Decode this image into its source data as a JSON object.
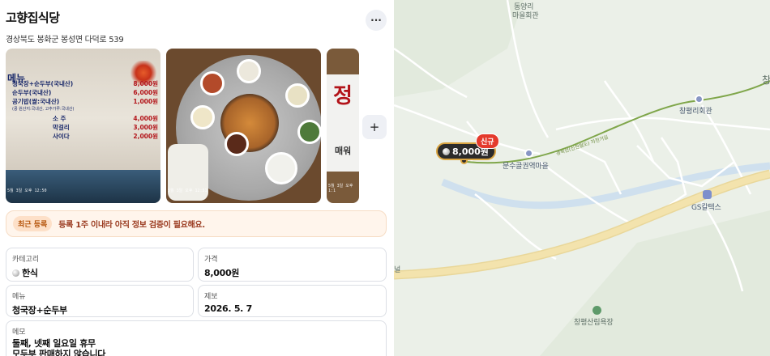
{
  "place": {
    "title": "고향집식당",
    "address": "경상북도 봉화군 봉성면 다덕로 539"
  },
  "actions": {
    "more_icon": "more-icon",
    "more_label": "···",
    "add_label": "+"
  },
  "photos": [
    {
      "stamp": "5월 3일 오후 12:50",
      "menu": [
        {
          "name": "청국장+순두부(국내산)",
          "price": "8,000원"
        },
        {
          "name": "순두부(국내산)",
          "price": "6,000원"
        },
        {
          "name": "공기밥(쌀:국내산)",
          "price": "1,000원"
        }
      ],
      "menu_note": "(콩 원산지:국내산, 고추가루:국내산)",
      "drinks": [
        {
          "name": "소 주",
          "price": "4,000원"
        },
        {
          "name": "막걸리",
          "price": "3,000원"
        },
        {
          "name": "사이다",
          "price": "2,000원"
        }
      ],
      "header_text": "메뉴"
    },
    {
      "stamp": "5월 3일 오후 12:51"
    },
    {
      "stamp": "5월 3일 오후 1:1",
      "sign": "정",
      "sign_sub": "매워"
    }
  ],
  "notice": {
    "badge": "최근 등록",
    "text": "등록 1주 이내라 아직 정보 검증이 필요해요."
  },
  "info": {
    "category_label": "카테고리",
    "category_value": "한식",
    "price_label": "가격",
    "price_value": "8,000원",
    "menu_label": "메뉴",
    "menu_value": "청국장+순두부",
    "report_label": "제보",
    "report_value": "2026. 5. 7",
    "memo_label": "메모",
    "memo_line1": "둘째, 넷째 일요일 휴무",
    "memo_line2": "모두부 판매하지 않습니다"
  },
  "map": {
    "labels": {
      "village_top_1": "동양리",
      "village_top_2": "마을회관",
      "hall": "창평리회관",
      "station": "문수골권역마을",
      "gas": "GS칼텍스",
      "forest": "창평산림욕장",
      "edge_right": "창",
      "edge_left": "널",
      "rail": "경북선(신천철도) 자전거길"
    },
    "pin_price": "8,000원",
    "pin_badge": "신규",
    "colors": {
      "land": "#ebf0e8",
      "road_major": "#f2dfa3",
      "river": "#cfe0ee",
      "rail": "#7fa64a",
      "pin_border": "#d9a441"
    }
  }
}
